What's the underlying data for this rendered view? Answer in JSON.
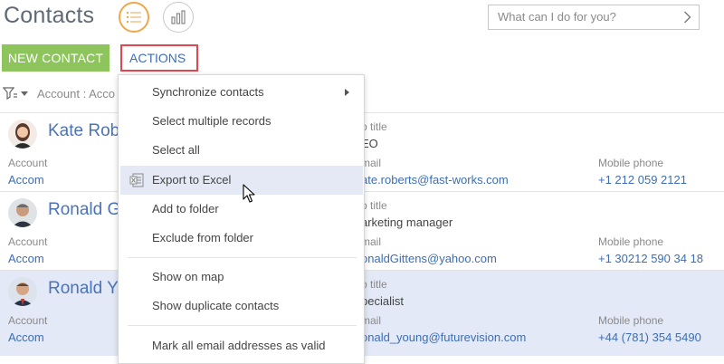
{
  "header": {
    "title": "Contacts",
    "search_placeholder": "What can I do for you?"
  },
  "toolbar": {
    "new_contact": "NEW CONTACT",
    "actions": "ACTIONS"
  },
  "filter": {
    "text": "Account : Acco"
  },
  "contacts": [
    {
      "name": "Kate Robe",
      "account_label": "Account",
      "account_value": "Accom",
      "job_title_label": "b title",
      "job_title": "EO",
      "email_label": "mail",
      "email": "ate.roberts@fast-works.com",
      "mobile_label": "Mobile phone",
      "mobile": "+1 212 059 2121"
    },
    {
      "name": "Ronald G",
      "account_label": "Account",
      "account_value": "Accom",
      "job_title_label": "b title",
      "job_title": "arketing manager",
      "email_label": "mail",
      "email": "onaldGittens@yahoo.com",
      "mobile_label": "Mobile phone",
      "mobile": "+1 30212 590 34 18"
    },
    {
      "name": "Ronald Yo",
      "account_label": "Account",
      "account_value": "Accom",
      "job_title_label": "b title",
      "job_title": "pecialist",
      "email_label": "mail",
      "email": "onald_young@futurevision.com",
      "mobile_label": "Mobile phone",
      "mobile": "+44 (781) 354 5490"
    }
  ],
  "menu": {
    "items": [
      "Synchronize contacts",
      "Select multiple records",
      "Select all",
      "Export to Excel",
      "Add to folder",
      "Exclude from folder",
      "Show on map",
      "Show duplicate contacts",
      "Mark all email addresses as valid"
    ]
  },
  "colors": {
    "accent_orange": "#f2a64a",
    "new_contact_green": "#8dc45c",
    "actions_border_red": "#e0474c",
    "link_blue": "#3d6eb4",
    "selected_row": "#e3e9f7",
    "menu_hover": "#e4e9f5"
  }
}
